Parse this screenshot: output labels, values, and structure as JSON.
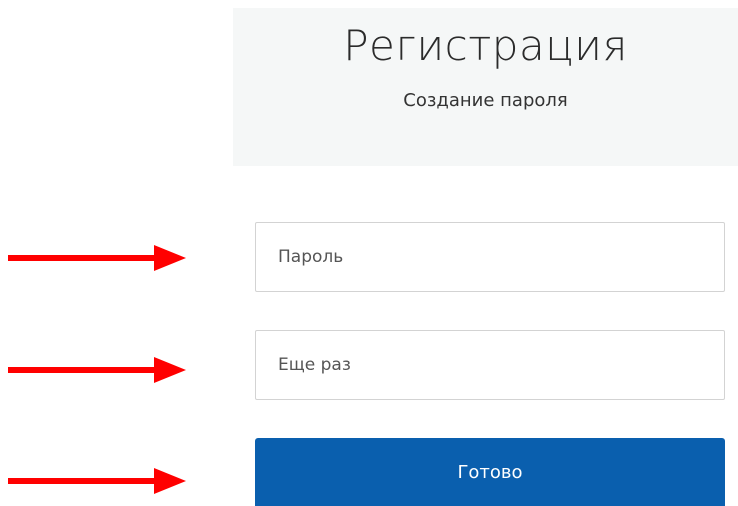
{
  "header": {
    "title": "Регистрация",
    "subtitle": "Создание пароля"
  },
  "form": {
    "password_placeholder": "Пароль",
    "repeat_placeholder": "Еще раз",
    "submit_label": "Готово"
  },
  "annotations": {
    "arrow_icon": "right-arrow-icon",
    "arrow_color": "#ff0000"
  },
  "colors": {
    "button_bg": "#0a5fae",
    "header_bg": "#f5f7f7"
  }
}
